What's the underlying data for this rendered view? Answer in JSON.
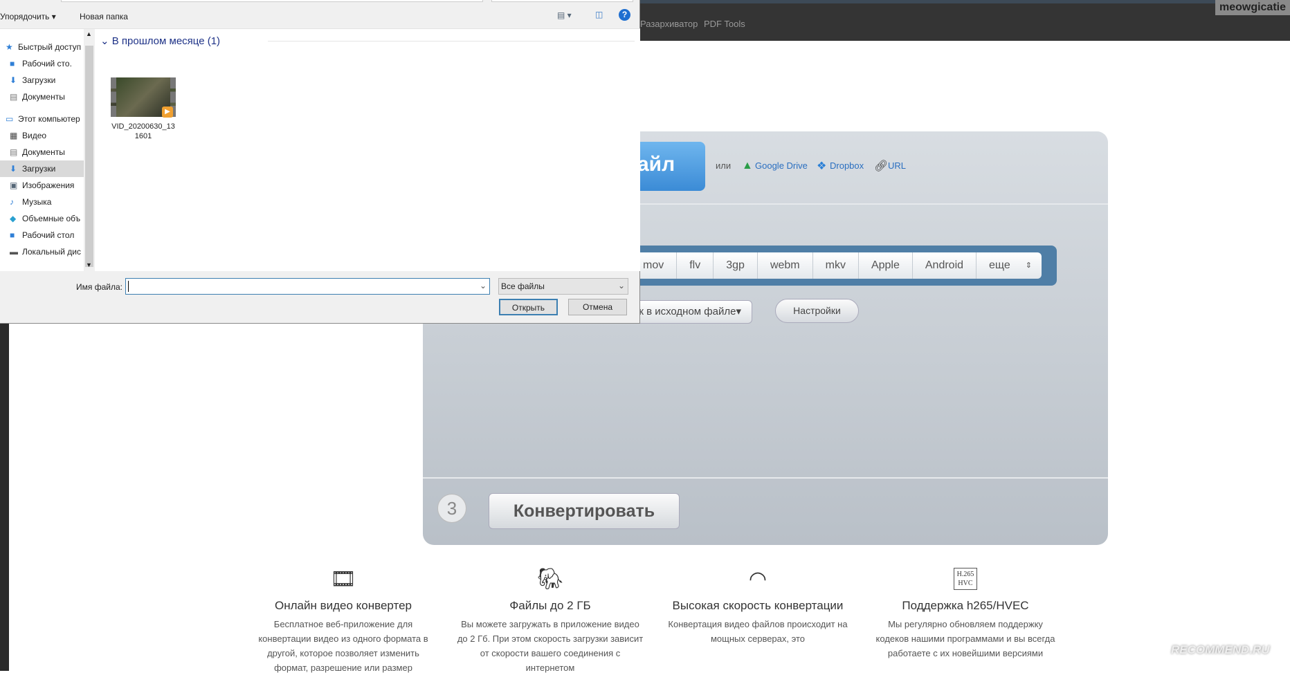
{
  "site": {
    "nav": [
      "Разархиватор",
      "PDF Tools"
    ],
    "username": "meowgicatie",
    "upload": {
      "choose_label": "айл",
      "or": "или",
      "links": [
        "Google Drive",
        "Dropbox",
        "URL"
      ]
    },
    "formats": [
      "mov",
      "flv",
      "3gp",
      "webm",
      "mkv",
      "Apple",
      "Android",
      "еще"
    ],
    "resolution": "ак в исходном файле",
    "settings": "Настройки",
    "step": "3",
    "convert": "Конвертировать",
    "features": [
      {
        "icon": "video-edit-icon",
        "title": "Онлайн видео конвертер",
        "text": "Бесплатное веб-приложение для конвертации видео из одного формата в другой, которое позволяет изменить формат, разрешение или размер"
      },
      {
        "icon": "elephant-icon",
        "title": "Файлы до 2 ГБ",
        "text": "Вы можете загружать в приложение видео до 2 Гб. При этом скорость загрузки зависит от скорости вашего соединения с интернетом"
      },
      {
        "icon": "speedometer-icon",
        "title": "Высокая скорость конвертации",
        "text": "Конвертация видео файлов происходит на мощных серверах, это"
      },
      {
        "icon": "h265-icon",
        "title": "Поддержка h265/HVEC",
        "text": "Мы регулярно обновляем поддержку кодеков нашими программами и вы всегда работаете с их новейшими версиями"
      }
    ]
  },
  "dialog": {
    "organize": "Упорядочить ▾",
    "new_folder": "Новая папка",
    "nav": [
      {
        "label": "Быстрый доступ",
        "icon": "star-icon",
        "sub": false
      },
      {
        "label": "Рабочий сто.",
        "icon": "desktop-icon",
        "sub": true,
        "pin": true
      },
      {
        "label": "Загрузки",
        "icon": "download-icon",
        "sub": true,
        "pin": true
      },
      {
        "label": "Документы",
        "icon": "document-icon",
        "sub": true,
        "pin": true
      },
      {
        "label": "Этот компьютер",
        "icon": "computer-icon",
        "sub": false
      },
      {
        "label": "Видео",
        "icon": "video-icon",
        "sub": true
      },
      {
        "label": "Документы",
        "icon": "document-icon",
        "sub": true
      },
      {
        "label": "Загрузки",
        "icon": "download-icon",
        "sub": true,
        "selected": true
      },
      {
        "label": "Изображения",
        "icon": "images-icon",
        "sub": true
      },
      {
        "label": "Музыка",
        "icon": "music-icon",
        "sub": true
      },
      {
        "label": "Объемные объ",
        "icon": "3d-objects-icon",
        "sub": true
      },
      {
        "label": "Рабочий стол",
        "icon": "desktop-icon",
        "sub": true
      },
      {
        "label": "Локальный дис",
        "icon": "drive-icon",
        "sub": true
      }
    ],
    "group": "В прошлом месяце (1)",
    "file": {
      "name_line1": "VID_20200630_13",
      "name_line2": "1601"
    },
    "filename_label": "Имя файла:",
    "filename_value": "",
    "filter": "Все файлы",
    "open": "Открыть",
    "cancel": "Отмена"
  },
  "watermark": "RECOMMEND.RU"
}
